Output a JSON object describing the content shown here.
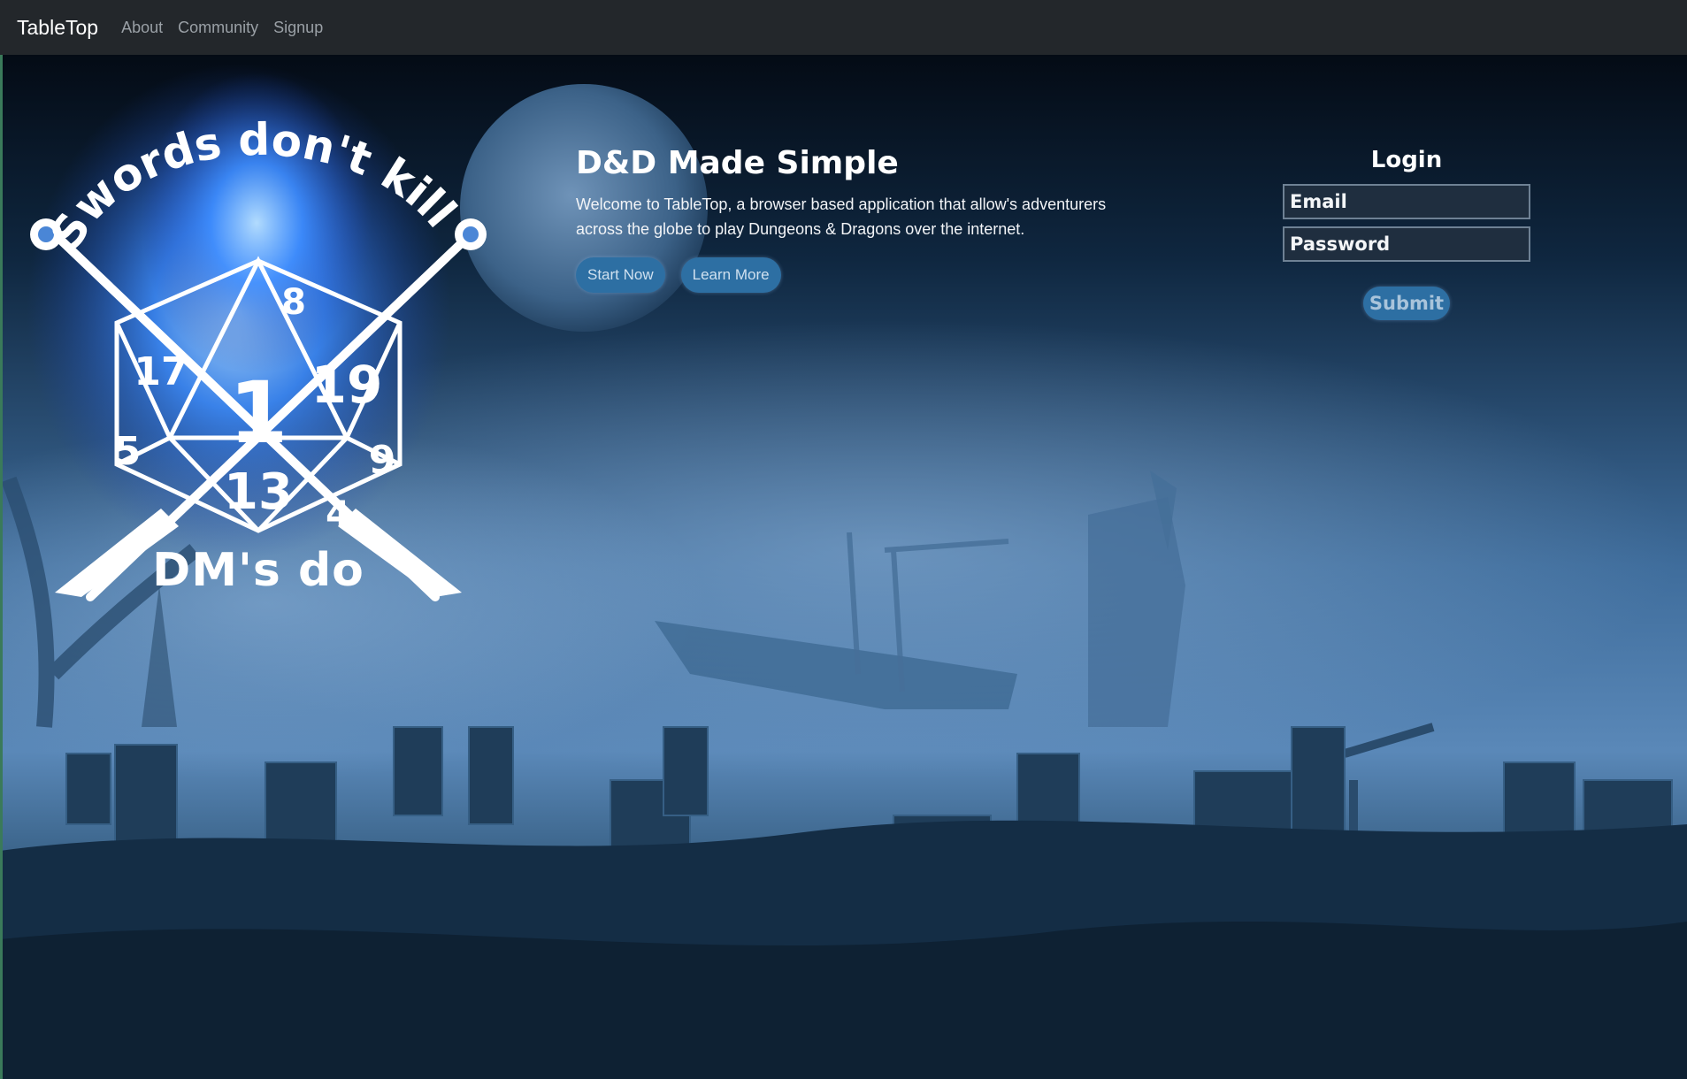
{
  "nav": {
    "brand": "TableTop",
    "links": [
      "About",
      "Community",
      "Signup"
    ]
  },
  "emblem": {
    "top_text": "Swords don't kill",
    "bottom_text": "DM's do",
    "die_numbers": [
      "1",
      "17",
      "19",
      "13",
      "5",
      "9",
      "4",
      "8"
    ]
  },
  "hero": {
    "title": "D&D Made Simple",
    "description": "Welcome to TableTop, a browser based application that allow's adventurers across the globe to play Dungeons & Dragons over the internet.",
    "start_label": "Start Now",
    "learn_label": "Learn More"
  },
  "login": {
    "title": "Login",
    "email_placeholder": "Email",
    "password_placeholder": "Password",
    "submit_label": "Submit"
  },
  "colors": {
    "navbar": "#23272b",
    "button": "#2d6fa3",
    "fog": "#5f8fc0",
    "flame": "#3d8cff"
  }
}
